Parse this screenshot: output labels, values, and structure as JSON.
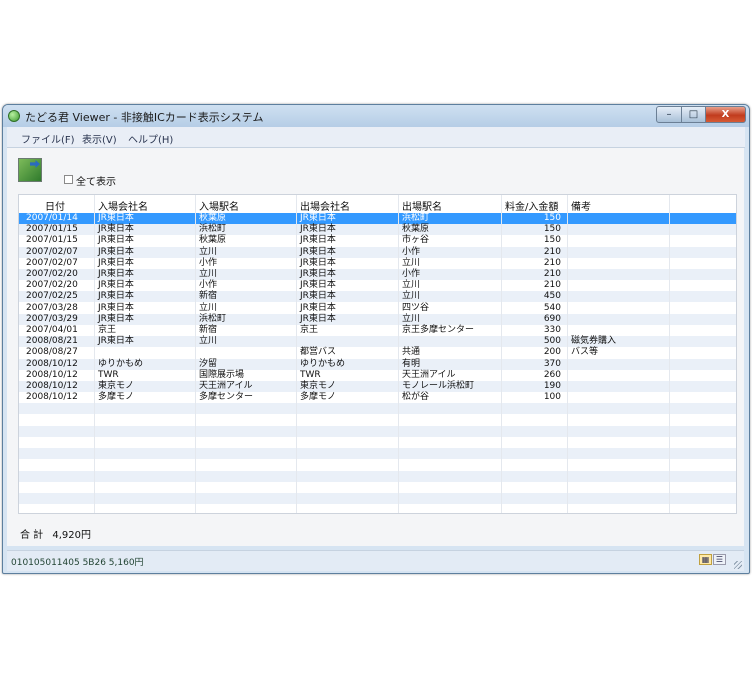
{
  "window": {
    "title": "たどる君 Viewer - 非接触ICカード表示システム",
    "min_glyph": "–",
    "max_glyph": "□",
    "close_glyph": "X"
  },
  "menu": {
    "items": [
      "ファイル(F)",
      "表示(V)",
      "ヘルプ(H)"
    ]
  },
  "toolbar": {
    "show_all_label": "全て表示"
  },
  "table": {
    "columns": [
      "日付",
      "入場会社名",
      "入場駅名",
      "出場会社名",
      "出場駅名",
      "料金/入金額",
      "備考"
    ],
    "rows": [
      [
        "2007/01/14",
        "JR東日本",
        "秋葉原",
        "JR東日本",
        "浜松町",
        "150",
        ""
      ],
      [
        "2007/01/15",
        "JR東日本",
        "浜松町",
        "JR東日本",
        "秋葉原",
        "150",
        ""
      ],
      [
        "2007/01/15",
        "JR東日本",
        "秋葉原",
        "JR東日本",
        "市ヶ谷",
        "150",
        ""
      ],
      [
        "2007/02/07",
        "JR東日本",
        "立川",
        "JR東日本",
        "小作",
        "210",
        ""
      ],
      [
        "2007/02/07",
        "JR東日本",
        "小作",
        "JR東日本",
        "立川",
        "210",
        ""
      ],
      [
        "2007/02/20",
        "JR東日本",
        "立川",
        "JR東日本",
        "小作",
        "210",
        ""
      ],
      [
        "2007/02/20",
        "JR東日本",
        "小作",
        "JR東日本",
        "立川",
        "210",
        ""
      ],
      [
        "2007/02/25",
        "JR東日本",
        "新宿",
        "JR東日本",
        "立川",
        "450",
        ""
      ],
      [
        "2007/03/28",
        "JR東日本",
        "立川",
        "JR東日本",
        "四ツ谷",
        "540",
        ""
      ],
      [
        "2007/03/29",
        "JR東日本",
        "浜松町",
        "JR東日本",
        "立川",
        "690",
        ""
      ],
      [
        "2007/04/01",
        "京王",
        "新宿",
        "京王",
        "京王多摩センター",
        "330",
        ""
      ],
      [
        "2008/08/21",
        "JR東日本",
        "立川",
        "",
        "",
        "500",
        "磁気券購入"
      ],
      [
        "2008/08/27",
        "",
        "",
        "都営バス",
        "共通",
        "200",
        "バス等"
      ],
      [
        "2008/10/12",
        "ゆりかもめ",
        "汐留",
        "ゆりかもめ",
        "有明",
        "370",
        ""
      ],
      [
        "2008/10/12",
        "TWR",
        "国際展示場",
        "TWR",
        "天王洲アイル",
        "260",
        ""
      ],
      [
        "2008/10/12",
        "東京モノ",
        "天王洲アイル",
        "東京モノ",
        "モノレール浜松町",
        "190",
        ""
      ],
      [
        "2008/10/12",
        "多摩モノ",
        "多摩センター",
        "多摩モノ",
        "松が谷",
        "100",
        ""
      ]
    ],
    "selected_row": 0
  },
  "summary": {
    "total_label": "合 計",
    "total_value": "4,920円"
  },
  "status": {
    "card_info": "010105011405 5B26    5,160円"
  },
  "colors": {
    "selection": "#3399ff",
    "title_bar": "#b5cde6",
    "close_button": "#c13c1e"
  }
}
